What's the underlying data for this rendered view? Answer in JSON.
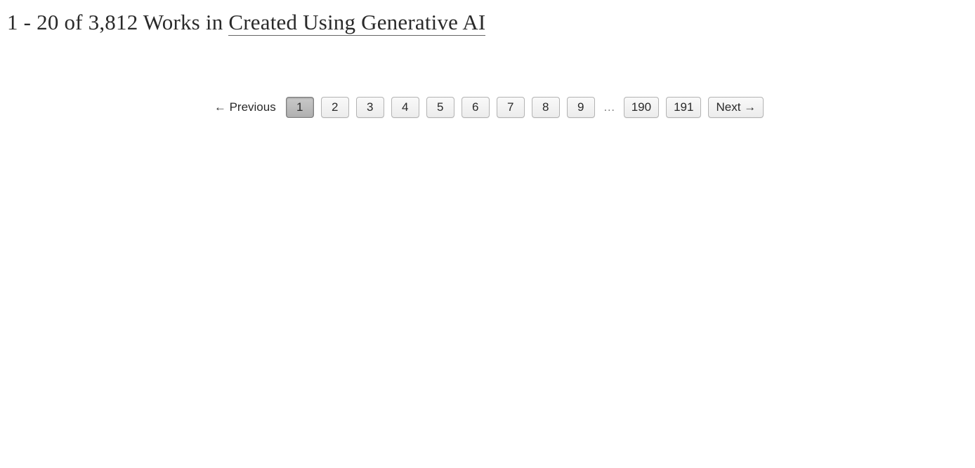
{
  "heading": {
    "range_text": "1 - 20 of 3,812 Works in ",
    "link_text": "Created Using Generative AI"
  },
  "pagination": {
    "prev": "← Previous",
    "next": "Next →",
    "gap": "…",
    "pages": [
      "1",
      "2",
      "3",
      "4",
      "5",
      "6",
      "7",
      "8",
      "9"
    ],
    "tail": [
      "190",
      "191"
    ]
  }
}
